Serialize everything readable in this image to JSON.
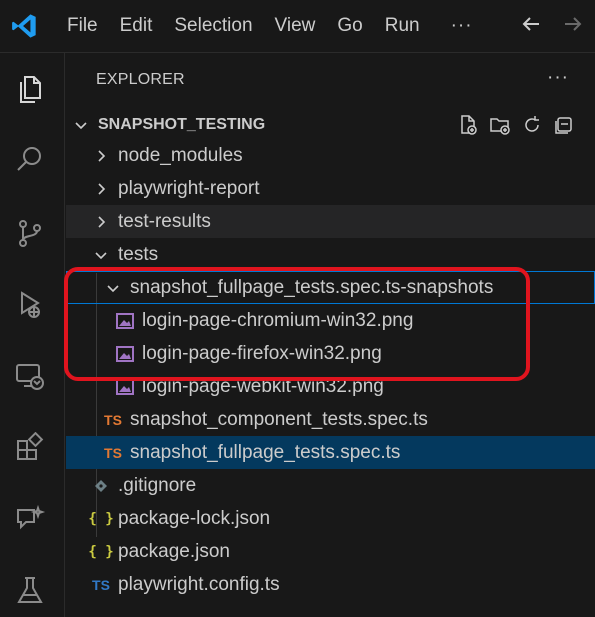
{
  "menu": {
    "items": [
      "File",
      "Edit",
      "Selection",
      "View",
      "Go",
      "Run"
    ],
    "more": "···"
  },
  "activity": [
    "explorer-icon",
    "search-icon",
    "source-control-icon",
    "run-debug-icon",
    "remote-explorer-icon",
    "extensions-icon",
    "chat-icon",
    "testing-icon"
  ],
  "explorer": {
    "header": "EXPLORER",
    "more": "···",
    "section_title": "SNAPSHOT_TESTING",
    "tree": [
      {
        "label": "node_modules",
        "type": "folder-collapsed"
      },
      {
        "label": "playwright-report",
        "type": "folder-collapsed"
      },
      {
        "label": "test-results",
        "type": "folder-collapsed"
      },
      {
        "label": "tests",
        "type": "folder-open"
      },
      {
        "label": "snapshot_fullpage_tests.spec.ts-snapshots",
        "type": "folder-open"
      },
      {
        "label": "login-page-chromium-win32.png",
        "type": "image"
      },
      {
        "label": "login-page-firefox-win32.png",
        "type": "image"
      },
      {
        "label": "login-page-webkit-win32.png",
        "type": "image"
      },
      {
        "label": "snapshot_component_tests.spec.ts",
        "type": "ts",
        "icon_text": "TS"
      },
      {
        "label": "snapshot_fullpage_tests.spec.ts",
        "type": "ts",
        "icon_text": "TS",
        "selected": true
      },
      {
        "label": ".gitignore",
        "type": "gitignore"
      },
      {
        "label": "package-lock.json",
        "type": "json",
        "icon_text": "{ }"
      },
      {
        "label": "package.json",
        "type": "json",
        "icon_text": "{ }"
      },
      {
        "label": "playwright.config.ts",
        "type": "ts-config",
        "icon_text": "TS"
      }
    ]
  },
  "colors": {
    "accent": "#0078d4",
    "selection": "#04395e",
    "highlight": "#e0141e",
    "ts": "#e37933"
  }
}
